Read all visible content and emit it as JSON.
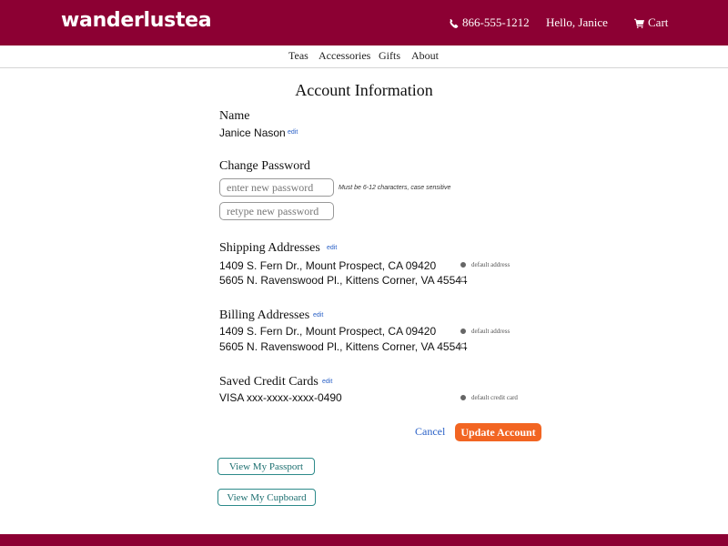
{
  "header": {
    "logo": "wanderlustea",
    "phone": "866-555-1212",
    "greeting": "Hello, Janice",
    "cart_label": "Cart",
    "bg_color": "#8c0033"
  },
  "nav": {
    "items": [
      {
        "label": "Teas"
      },
      {
        "label": "Accessories"
      },
      {
        "label": "Gifts"
      },
      {
        "label": "About"
      }
    ]
  },
  "page": {
    "title": "Account Information"
  },
  "name_section": {
    "heading": "Name",
    "value": "Janice Nason",
    "edit_label": "edit"
  },
  "password_section": {
    "heading": "Change Password",
    "new_placeholder": "enter new password",
    "retype_placeholder": "retype new password",
    "hint": "Must be 6-12 characters, case sensitive"
  },
  "shipping": {
    "heading": "Shipping Addresses",
    "edit_label": "edit",
    "addresses": [
      {
        "text": "1409 S. Fern Dr., Mount Prospect, CA  09420",
        "selected": true,
        "note": "default address"
      },
      {
        "text": "5605 N. Ravenswood Pl., Kittens Corner, VA  45544",
        "selected": false,
        "note": ""
      }
    ]
  },
  "billing": {
    "heading": "Billing Addresses",
    "edit_label": "edit",
    "addresses": [
      {
        "text": "1409 S. Fern Dr., Mount Prospect, CA  09420",
        "selected": true,
        "note": "default address"
      },
      {
        "text": "5605 N. Ravenswood Pl., Kittens Corner, VA  45544",
        "selected": false,
        "note": ""
      }
    ]
  },
  "cards": {
    "heading": "Saved Credit Cards",
    "edit_label": "edit",
    "items": [
      {
        "text": "VISA xxx-xxxx-xxxx-0490",
        "selected": true,
        "note": "default credit card"
      }
    ]
  },
  "actions": {
    "cancel_label": "Cancel",
    "update_label": "Update Account",
    "update_color": "#f26522"
  },
  "links": {
    "passport_label": "View My Passport",
    "cupboard_label": "View My Cupboard"
  },
  "icons": {
    "phone": "phone-icon",
    "cart": "cart-icon"
  }
}
